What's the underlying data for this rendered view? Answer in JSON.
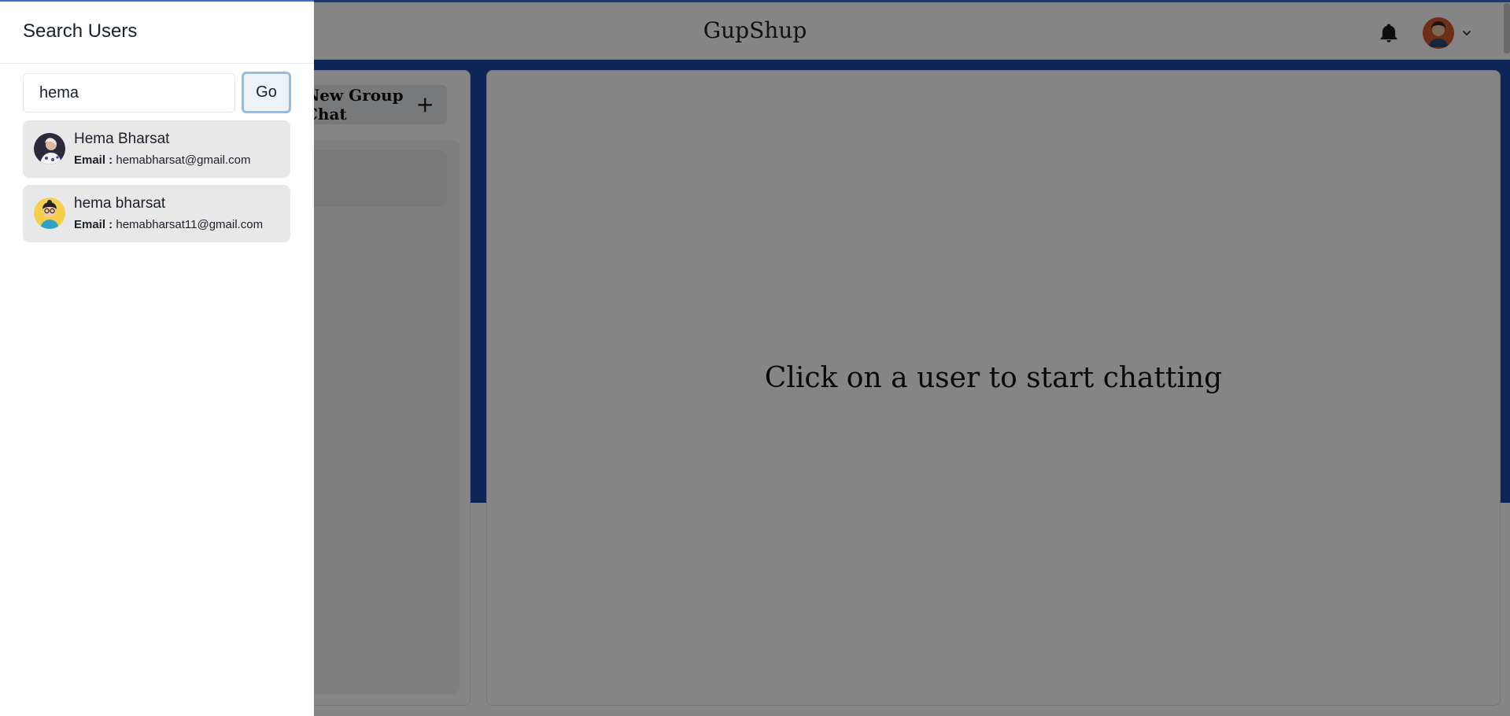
{
  "app": {
    "title": "GupShup"
  },
  "left_panel": {
    "new_group_label": "New Group Chat"
  },
  "main": {
    "empty_message": "Click on a user to start chatting"
  },
  "drawer": {
    "title": "Search Users",
    "search": {
      "value": "hema",
      "go_label": "Go"
    },
    "results": [
      {
        "name": "Hema Bharsat",
        "email_label": "Email :",
        "email": "hemabharsat@gmail.com",
        "avatar": "photo-avatar"
      },
      {
        "name": "hema bharsat",
        "email_label": "Email :",
        "email": "hemabharsat11@gmail.com",
        "avatar": "cartoon-avatar"
      }
    ]
  },
  "icons": {
    "notification": "bell-icon",
    "profile": "user-avatar",
    "menu": "chevron-down-icon",
    "add": "plus-icon"
  },
  "colors": {
    "accent": "#1a4aa8",
    "header_border": "#3d6fc9",
    "go_focus": "#90bde8",
    "result_bg": "#e8e8e8"
  }
}
